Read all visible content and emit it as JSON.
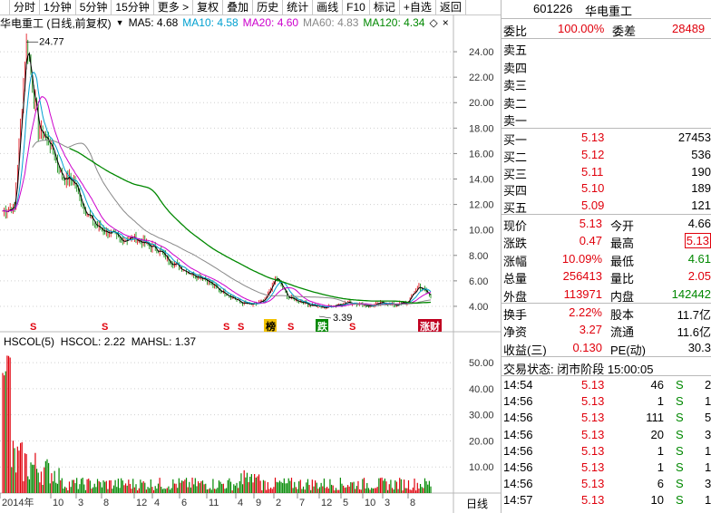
{
  "toolbar": {
    "items": [
      "分时",
      "1分钟",
      "5分钟",
      "15分钟",
      "更多 >",
      "复权",
      "叠加",
      "历史",
      "统计",
      "画线",
      "F10",
      "标记",
      "+自选",
      "返回"
    ]
  },
  "stock": {
    "code": "601226",
    "name": "华电重工"
  },
  "legend": {
    "title": "华电重工 (日线,前复权)",
    "ma5": "MA5: 4.68",
    "ma10": "MA10: 4.58",
    "ma20": "MA20: 4.60",
    "ma60": "MA60: 4.83",
    "ma120": "MA120: 4.34"
  },
  "colors": {
    "ma5": "#000000",
    "ma10": "#00a0d0",
    "ma20": "#cc00cc",
    "ma60": "#888888",
    "ma120": "#008800",
    "up": "#e0000c",
    "down": "#008800"
  },
  "indicator_legend": {
    "name": "HSCOL(5)",
    "hscol": "HSCOL: 2.22",
    "mahsl": "MAHSL: 1.37"
  },
  "chart_data": [
    {
      "type": "line",
      "title": "华电重工 (日线,前复权)",
      "y_ticks": [
        "24.00",
        "22.00",
        "20.00",
        "18.00",
        "16.00",
        "14.00",
        "12.00",
        "10.00",
        "8.00",
        "6.00",
        "4.00"
      ],
      "ylim": [
        3.0,
        25.5
      ],
      "x_ticks": [
        "2014年",
        "10",
        "3",
        "8",
        "12",
        "4",
        "6",
        "11",
        "4",
        "9",
        "2",
        "7",
        "12",
        "5",
        "10",
        "3",
        "8"
      ],
      "annotations": {
        "high": "24.77",
        "low": "3.39"
      },
      "markers": [
        "S",
        "S",
        "S",
        "S",
        "榜",
        "S",
        "跌",
        "S",
        "涨财"
      ],
      "close_samples": [
        11.5,
        11.8,
        24.77,
        18,
        16.8,
        14.2,
        13.8,
        11.4,
        10.2,
        9.8,
        9.2,
        9.4,
        8.9,
        8.5,
        7.6,
        7.0,
        6.5,
        6.2,
        5.4,
        4.9,
        4.3,
        4.1,
        4.4,
        6.3,
        4.7,
        4.4,
        4.1,
        3.9,
        4.1,
        4.3,
        4.2,
        4.0,
        4.3,
        4.1,
        4.3,
        5.6,
        4.8
      ]
    },
    {
      "type": "bar",
      "title": "HSCOL(5)",
      "y_ticks": [
        "50.00",
        "40.00",
        "30.00",
        "20.00",
        "10.00"
      ],
      "ylim": [
        0,
        57
      ],
      "series": [
        {
          "name": "HSCOL",
          "last": 2.22
        },
        {
          "name": "MAHSL",
          "last": 1.37
        }
      ]
    }
  ],
  "period_label": "日线",
  "quote": {
    "weibi_label": "委比",
    "weibi_value": "100.00%",
    "weicha_label": "委差",
    "weicha_value": "28489",
    "asks": [
      {
        "label": "卖五"
      },
      {
        "label": "卖四"
      },
      {
        "label": "卖三"
      },
      {
        "label": "卖二"
      },
      {
        "label": "卖一"
      }
    ],
    "bids": [
      {
        "label": "买一",
        "price": "5.13",
        "vol": "27453"
      },
      {
        "label": "买二",
        "price": "5.12",
        "vol": "536"
      },
      {
        "label": "买三",
        "price": "5.11",
        "vol": "190"
      },
      {
        "label": "买四",
        "price": "5.10",
        "vol": "189"
      },
      {
        "label": "买五",
        "price": "5.09",
        "vol": "121"
      }
    ],
    "stats": [
      {
        "l1": "现价",
        "v1": "5.13",
        "l2": "今开",
        "v2": "4.66"
      },
      {
        "l1": "涨跌",
        "v1": "0.47",
        "l2": "最高",
        "v2": "5.13"
      },
      {
        "l1": "涨幅",
        "v1": "10.09%",
        "l2": "最低",
        "v2": "4.61"
      },
      {
        "l1": "总量",
        "v1": "256413",
        "l2": "量比",
        "v2": "2.05"
      },
      {
        "l1": "外盘",
        "v1": "113971",
        "l2": "内盘",
        "v2": "142442"
      }
    ],
    "stats2": [
      {
        "l1": "换手",
        "v1": "2.22%",
        "l2": "股本",
        "v2": "11.7亿"
      },
      {
        "l1": "净资",
        "v1": "3.27",
        "l2": "流通",
        "v2": "11.6亿"
      },
      {
        "l1": "收益(三)",
        "v1": "0.130",
        "l2": "PE(动)",
        "v2": "30.3"
      }
    ],
    "trade_status": "交易状态: 闭市阶段 15:00:05",
    "ticks": [
      {
        "time": "14:54",
        "price": "5.13",
        "vol": "46",
        "side": "S",
        "n": "2"
      },
      {
        "time": "14:56",
        "price": "5.13",
        "vol": "1",
        "side": "S",
        "n": "1"
      },
      {
        "time": "14:56",
        "price": "5.13",
        "vol": "111",
        "side": "S",
        "n": "5"
      },
      {
        "time": "14:56",
        "price": "5.13",
        "vol": "20",
        "side": "S",
        "n": "3"
      },
      {
        "time": "14:56",
        "price": "5.13",
        "vol": "1",
        "side": "S",
        "n": "1"
      },
      {
        "time": "14:56",
        "price": "5.13",
        "vol": "1",
        "side": "S",
        "n": "1"
      },
      {
        "time": "14:56",
        "price": "5.13",
        "vol": "6",
        "side": "S",
        "n": "3"
      },
      {
        "time": "14:57",
        "price": "5.13",
        "vol": "10",
        "side": "S",
        "n": "1"
      }
    ]
  }
}
